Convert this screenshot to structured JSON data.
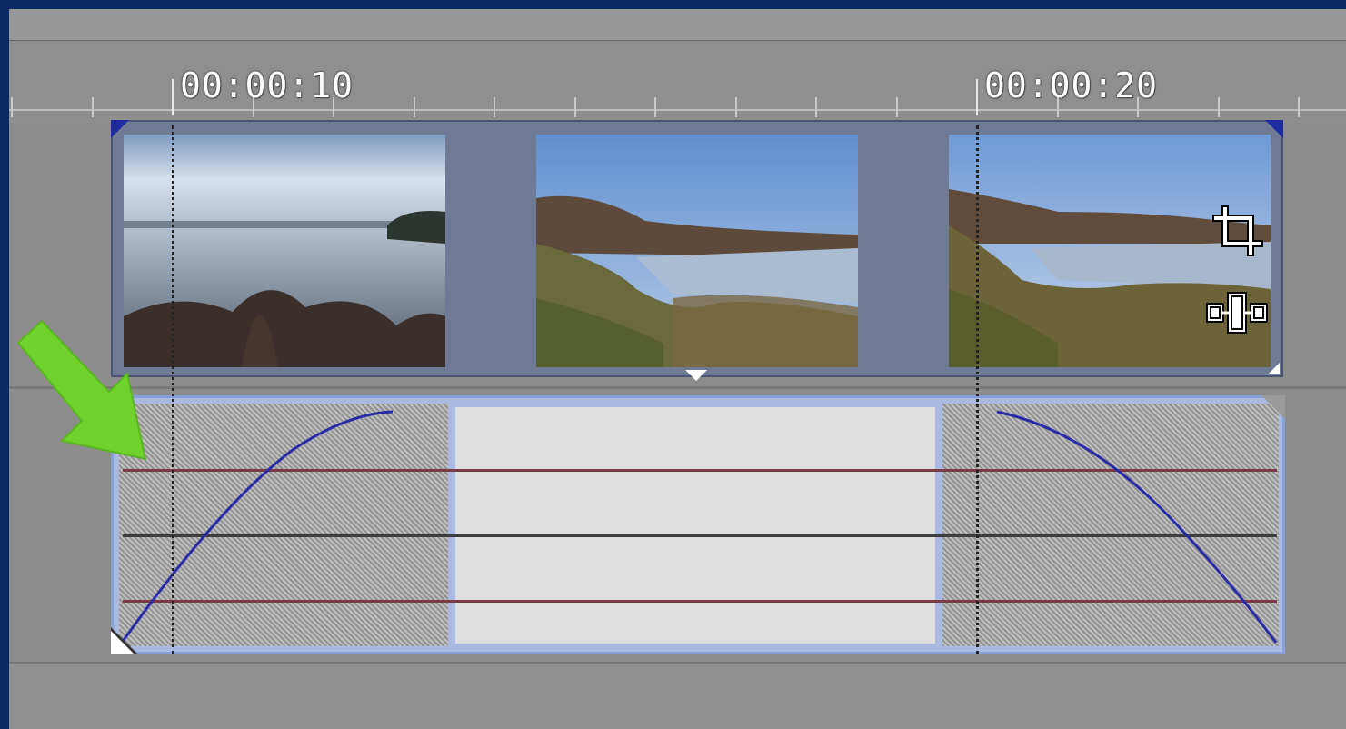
{
  "ruler": {
    "labels": [
      "00:00:10",
      "00:00:20"
    ]
  },
  "video_event": {
    "thumbnails": [
      "lake-misty-thumbnail",
      "lake-reeds-thumbnail",
      "lake-shore-thumbnail"
    ],
    "icons": [
      "crop-icon",
      "event-pan-icon"
    ]
  },
  "envelope": {
    "fade_in": "fade-in-curve",
    "fade_out": "fade-out-curve"
  },
  "annotation": {
    "arrow_color": "#6fd12b"
  },
  "colors": {
    "frame": "#0b2a63",
    "event_border": "#88a0d8",
    "curve": "#2a2aa8",
    "arrow": "#6fd12b"
  }
}
